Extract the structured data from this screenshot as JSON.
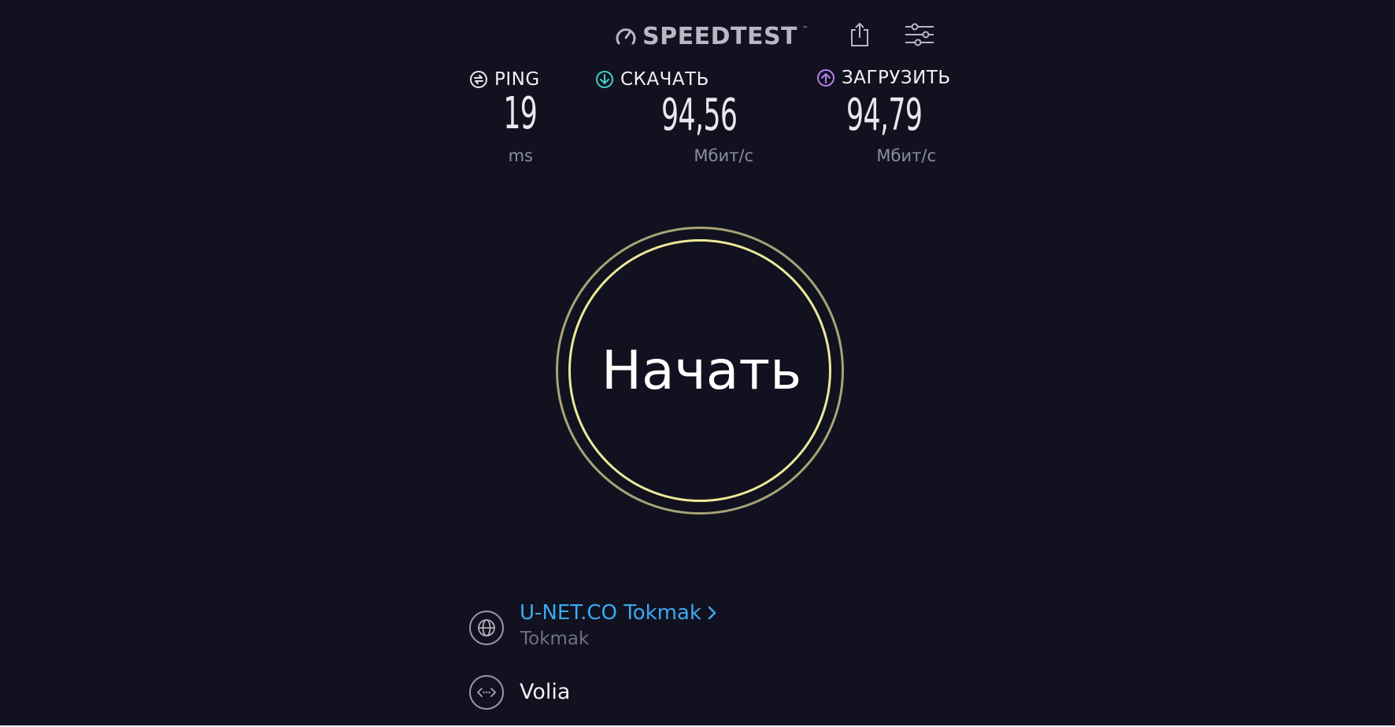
{
  "header": {
    "logo_text": "SPEEDTEST",
    "logo_tm": "™",
    "icons": [
      "speedometer-icon",
      "share-icon",
      "settings-sliders-icon"
    ]
  },
  "metrics": {
    "ping": {
      "label": "PING",
      "value": "19",
      "unit": "ms",
      "icon": "ping-icon",
      "color": "#e8e8ee"
    },
    "download": {
      "label": "СКАЧАТЬ",
      "value": "94,56",
      "unit": "Мбит/с",
      "icon": "download-arrow-icon",
      "color": "#3fd1c8"
    },
    "upload": {
      "label": "ЗАГРУЗИТЬ",
      "value": "94,79",
      "unit": "Мбит/с",
      "icon": "upload-arrow-icon",
      "color": "#b97ff0"
    }
  },
  "start_button": {
    "label": "Начать",
    "ring_color": "#ece89a"
  },
  "server": {
    "name": "U-NET.CO Tokmak",
    "location": "Tokmak",
    "name_color": "#3aa9f0",
    "icon": "globe-icon"
  },
  "isp": {
    "name": "Volia",
    "icon": "connection-icon"
  },
  "colors": {
    "background": "#11111f"
  }
}
